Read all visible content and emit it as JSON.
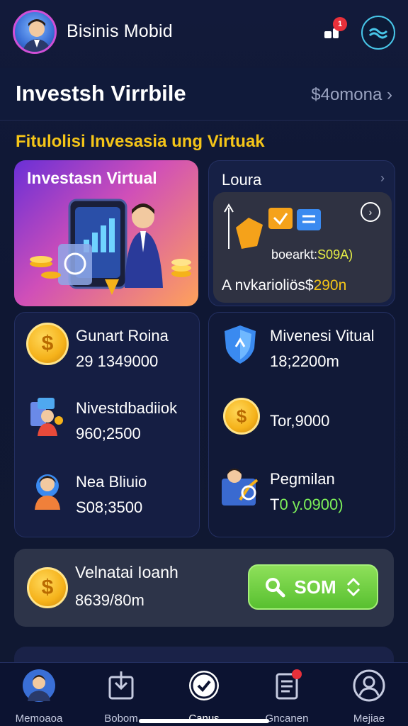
{
  "header": {
    "app_title": "Bisinis Mobid",
    "notification_count": "1"
  },
  "section": {
    "title": "Investsh Virrbile",
    "balance_link": "$4omona"
  },
  "subtitle": "Fitulolisi Invesasia ung Virtuak",
  "hero_card": {
    "title": "Investasn Virtual"
  },
  "loan_card": {
    "title": "Loura",
    "value_prefix": "boearkt:",
    "value_highlight": "S09A)",
    "caption_prefix": "A nvkarioliös$",
    "caption_highlight": "290n"
  },
  "left_stats": [
    {
      "label": "Gunart Roina",
      "value": "29 1349000"
    },
    {
      "label": "Nivestdbadiiok",
      "value": "960;2500"
    },
    {
      "label": "Nea Bliuio",
      "value": "S08;3500"
    }
  ],
  "right_stats": [
    {
      "label": "Mivenesi Vitual",
      "value": "18;2200m"
    },
    {
      "label": "",
      "value": "Tor,9000"
    },
    {
      "label": "Pegmilan",
      "value_prefix": "T",
      "value_highlight": "0 y.0900)"
    }
  ],
  "bottom_card": {
    "title": "Velnatai Ioanh",
    "value": "8639/80m",
    "button_label": "SOM"
  },
  "tabs": [
    {
      "label": "Memoaoa"
    },
    {
      "label": "Bobom"
    },
    {
      "label": "Canus"
    },
    {
      "label": "Gncanen"
    },
    {
      "label": "Mejiae"
    }
  ],
  "colors": {
    "accent_yellow": "#f5c518",
    "accent_green": "#58c030",
    "highlight_green": "#7df05a",
    "background": "#121a3a"
  }
}
